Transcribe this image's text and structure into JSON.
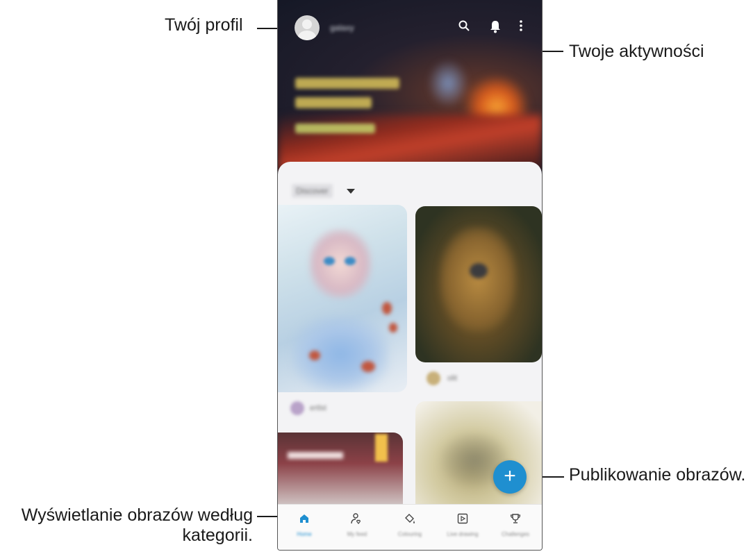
{
  "annotations": {
    "profile": "Twój profil",
    "activities": "Twoje aktywności",
    "publish": "Publikowanie obrazów.",
    "categories_line1": "Wyświetlanie obrazów według",
    "categories_line2": "kategorii."
  },
  "app": {
    "header": {
      "username": "galaxy",
      "icons": [
        "search-icon",
        "bell-icon",
        "more-vert-icon"
      ]
    },
    "banner": {
      "accent": "#d75a1d"
    },
    "feed": {
      "sort_label": "Discover",
      "cards": [
        {
          "user": "ertlst"
        },
        {
          "user": "olit"
        }
      ]
    },
    "fab": {
      "icon": "plus-icon",
      "label": "+",
      "color": "#1f8fd0"
    },
    "nav": {
      "items": [
        {
          "label": "Home",
          "icon": "home-icon",
          "active": true
        },
        {
          "label": "My feed",
          "icon": "profile-heart-icon"
        },
        {
          "label": "Colouring",
          "icon": "paint-bucket-icon"
        },
        {
          "label": "Live drawing",
          "icon": "play-box-icon"
        },
        {
          "label": "Challenges",
          "icon": "trophy-icon"
        }
      ]
    }
  }
}
